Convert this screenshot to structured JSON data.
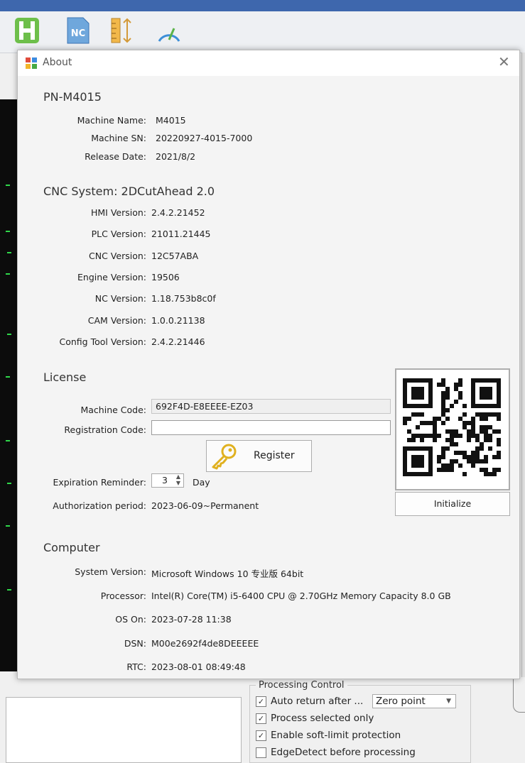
{
  "toolbar": {
    "icons": [
      "layout-icon",
      "nc-file-icon",
      "ruler-icon",
      "gauge-icon"
    ],
    "nc_label": "NC"
  },
  "dialog": {
    "title": "About",
    "model": "PN-M4015",
    "machine": {
      "name_label": "Machine Name:",
      "name": "M4015",
      "sn_label": "Machine SN:",
      "sn": "20220927-4015-7000",
      "release_label": "Release Date:",
      "release": "2021/8/2"
    },
    "cnc": {
      "heading": "CNC System: 2DCutAhead 2.0",
      "rows": [
        {
          "label": "HMI Version:",
          "value": "2.4.2.21452"
        },
        {
          "label": "PLC Version:",
          "value": "21011.21445"
        },
        {
          "label": "CNC Version:",
          "value": "12C57ABA"
        },
        {
          "label": "Engine Version:",
          "value": "19506"
        },
        {
          "label": "NC Version:",
          "value": "1.18.753b8c0f"
        },
        {
          "label": "CAM Version:",
          "value": "1.0.0.21138"
        },
        {
          "label": "Config Tool Version:",
          "value": "2.4.2.21446"
        }
      ]
    },
    "license": {
      "heading": "License",
      "machine_code_label": "Machine Code:",
      "machine_code": "692F4D-E8EEEE-EZ03",
      "reg_code_label": "Registration Code:",
      "reg_code": "",
      "register_label": "Register",
      "expiration_label": "Expiration Reminder:",
      "expiration_value": "3",
      "expiration_unit": "Day",
      "auth_label": "Authorization period:",
      "auth_value": "2023-06-09~Permanent",
      "initialize_label": "Initialize"
    },
    "computer": {
      "heading": "Computer",
      "rows": [
        {
          "label": "System Version:",
          "value": "Microsoft Windows 10 专业版 64bit"
        },
        {
          "label": "Processor:",
          "value": "Intel(R) Core(TM) i5-6400 CPU @ 2.70GHz Memory Capacity 8.0 GB"
        },
        {
          "label": "OS On:",
          "value": "2023-07-28 11:38"
        },
        {
          "label": "DSN:",
          "value": "M00e2692f4de8DEEEEE"
        },
        {
          "label": "RTC:",
          "value": "2023-08-01 08:49:48"
        }
      ]
    }
  },
  "processing": {
    "group_label": "Processing Control",
    "auto_return_label": "Auto return after ...",
    "auto_return_option": "Zero point",
    "auto_return_checked": true,
    "process_selected_label": "Process selected only",
    "process_selected_checked": true,
    "soft_limit_label": "Enable soft-limit protection",
    "soft_limit_checked": true,
    "edge_detect_label": "EdgeDetect before processing",
    "edge_detect_checked": false,
    "check_glyph": "✓"
  },
  "colors": {
    "accent": "#3e67ad",
    "key_icon": "#e0b120",
    "terminal_green": "#2fd84a"
  }
}
